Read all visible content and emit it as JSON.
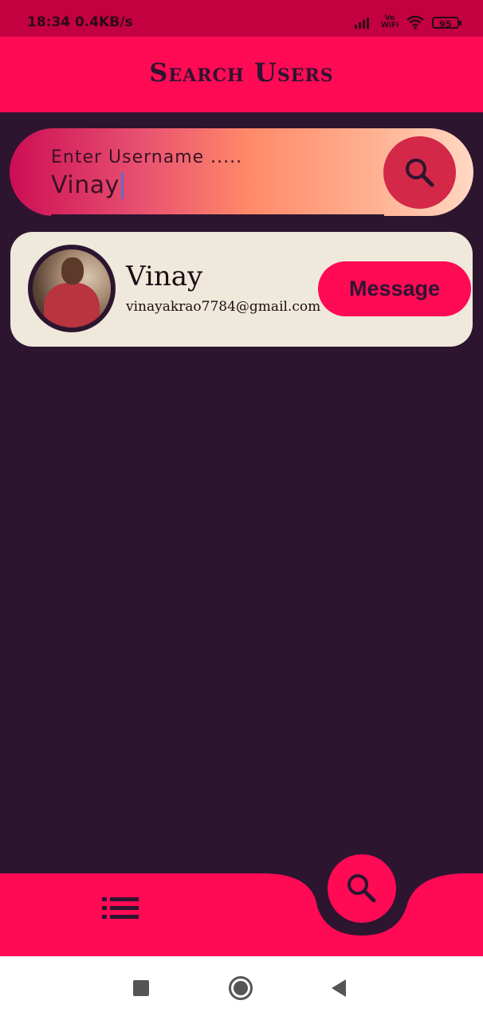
{
  "status_bar": {
    "time": "18:34",
    "network_speed": "0.4KB/s",
    "vowifi_label": "Vo\nWiFi",
    "battery_level": "95"
  },
  "app_bar": {
    "title": "Search Users"
  },
  "search": {
    "label": "Enter Username .....",
    "value": "Vinay",
    "button_icon": "search-icon"
  },
  "results": [
    {
      "name": "Vinay",
      "email": "vinayakrao7784@gmail.com",
      "message_label": "Message"
    }
  ],
  "bottom_nav": {
    "left_icon": "list-icon",
    "fab_icon": "search-icon"
  },
  "system_nav": {
    "recents_icon": "square-icon",
    "home_icon": "circle-icon",
    "back_icon": "triangle-back-icon"
  },
  "colors": {
    "accent": "#ff0a55",
    "status_bar": "#c30040",
    "background": "#2d1530",
    "card": "#efe9dc"
  }
}
